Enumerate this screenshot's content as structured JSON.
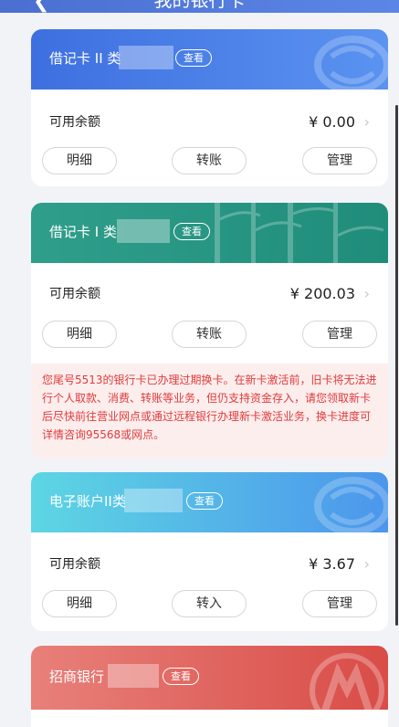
{
  "header": {
    "back_icon": "chevron-left-icon",
    "title": "我的银行卡"
  },
  "cards": [
    {
      "name": "借记卡 II 类",
      "view_label": "查看",
      "balance_label": "可用余额",
      "balance": "¥ 0.00",
      "actions": [
        "明细",
        "转账",
        "管理"
      ],
      "theme": "#4a7be0"
    },
    {
      "name": "借记卡 I 类",
      "view_label": "查看",
      "balance_label": "可用余额",
      "balance": "¥ 200.03",
      "actions": [
        "明细",
        "转账",
        "管理"
      ],
      "theme": "#2aa08a"
    },
    {
      "name": "电子账户II类",
      "view_label": "查看",
      "balance_label": "可用余额",
      "balance": "¥ 3.67",
      "actions": [
        "明细",
        "转入",
        "管理"
      ],
      "theme": "#4ac6e0"
    },
    {
      "name": "招商银行",
      "view_label": "查看",
      "theme": "#e06a66"
    }
  ],
  "notice": {
    "text": "您尾号5513的银行卡已办理过期换卡。在新卡激活前，旧卡将无法进行个人取款、消费、转账等业务，但仍支持资金存入，请您领取新卡后尽快前往营业网点或通过远程银行办理新卡激活业务，换卡进度可详情咨询95568或网点。",
    "color": "#e03b3b"
  }
}
